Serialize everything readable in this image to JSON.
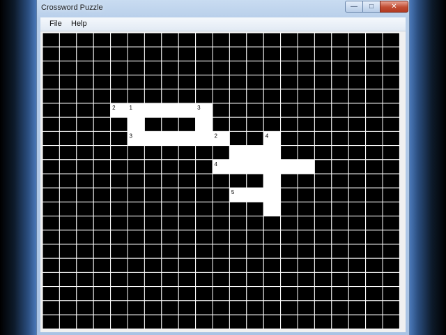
{
  "window": {
    "title": "Crossword Puzzle",
    "controls": {
      "minimize_icon": "minimize-icon",
      "maximize_icon": "maximize-icon",
      "close_icon": "close-icon"
    }
  },
  "menu": {
    "file": "File",
    "help": "Help"
  },
  "puzzle": {
    "rows": 21,
    "cols": 21,
    "open_cells": [
      [
        5,
        4
      ],
      [
        5,
        5
      ],
      [
        5,
        6
      ],
      [
        5,
        7
      ],
      [
        5,
        8
      ],
      [
        5,
        9
      ],
      [
        6,
        5
      ],
      [
        6,
        9
      ],
      [
        7,
        5
      ],
      [
        7,
        6
      ],
      [
        7,
        7
      ],
      [
        7,
        8
      ],
      [
        7,
        9
      ],
      [
        7,
        10
      ],
      [
        7,
        13
      ],
      [
        8,
        11
      ],
      [
        8,
        12
      ],
      [
        8,
        13
      ],
      [
        9,
        10
      ],
      [
        9,
        11
      ],
      [
        9,
        12
      ],
      [
        9,
        13
      ],
      [
        9,
        14
      ],
      [
        9,
        15
      ],
      [
        10,
        13
      ],
      [
        11,
        11
      ],
      [
        11,
        12
      ],
      [
        11,
        13
      ],
      [
        12,
        13
      ]
    ],
    "clue_numbers": [
      {
        "r": 5,
        "c": 4,
        "n": "2"
      },
      {
        "r": 5,
        "c": 5,
        "n": "1"
      },
      {
        "r": 5,
        "c": 9,
        "n": "3"
      },
      {
        "r": 7,
        "c": 5,
        "n": "3"
      },
      {
        "r": 7,
        "c": 10,
        "n": "2"
      },
      {
        "r": 7,
        "c": 13,
        "n": "4"
      },
      {
        "r": 9,
        "c": 10,
        "n": "4"
      },
      {
        "r": 11,
        "c": 11,
        "n": "5"
      }
    ],
    "colors": {
      "block": "#000000",
      "open": "#ffffff",
      "grid": "#ffffff",
      "number": "#000000"
    }
  }
}
